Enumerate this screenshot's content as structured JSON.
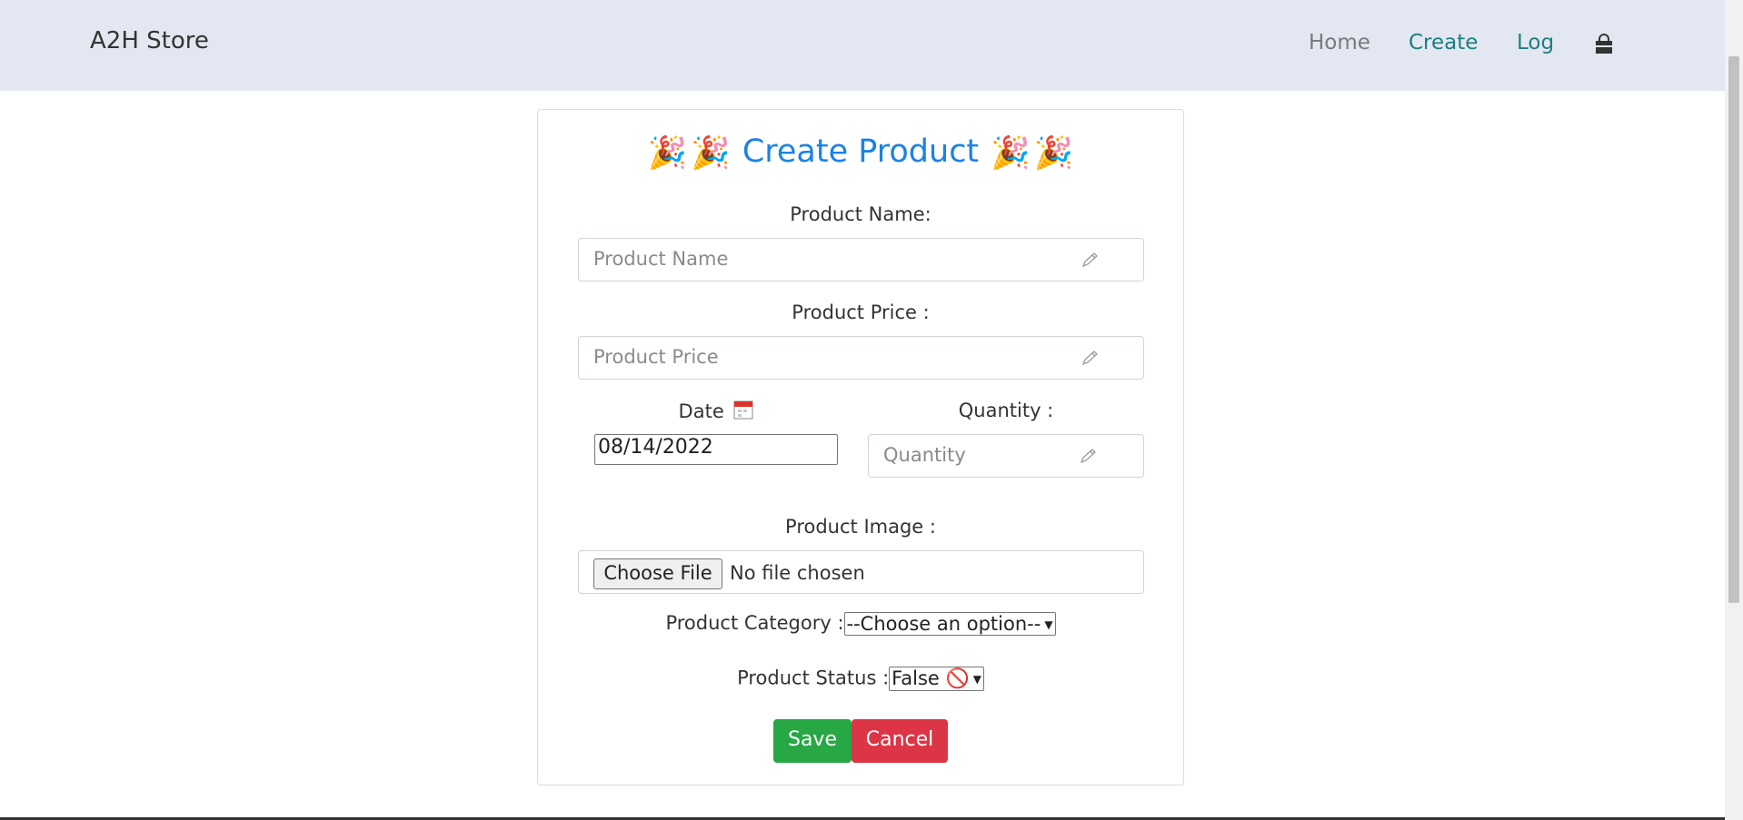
{
  "navbar": {
    "brand": "A2H Store",
    "links": [
      "Home",
      "Create",
      "Log"
    ],
    "bag_icon": "shopping-bag-icon"
  },
  "form": {
    "title": "Create Product",
    "title_emoji": "🎉",
    "product_name_label": "Product Name:",
    "product_name_placeholder": "Product Name",
    "product_price_label": "Product Price :",
    "product_price_placeholder": "Product Price",
    "date_label": "Date",
    "date_value": "08/14/2022",
    "quantity_label": "Quantity :",
    "quantity_placeholder": "Quantity",
    "image_label": "Product Image :",
    "choose_file": "Choose File",
    "no_file": "No file chosen",
    "category_label": "Product Category :",
    "category_selected": "--Choose an option--",
    "status_label": "Product Status :",
    "status_selected": "False 🚫",
    "save": "Save",
    "cancel": "Cancel"
  },
  "colors": {
    "accent": "#1a82e6",
    "nav_active": "#1d7f80",
    "save": "#28a745",
    "cancel": "#dc3545"
  }
}
